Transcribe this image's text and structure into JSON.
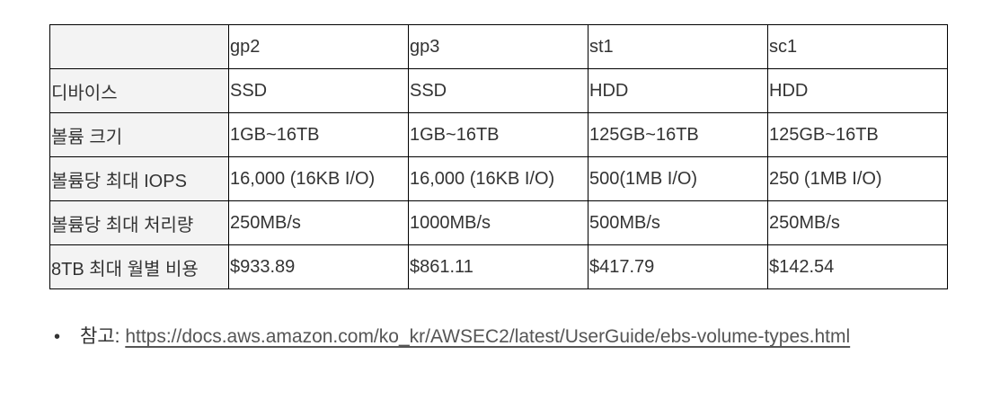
{
  "table": {
    "headers": [
      "",
      "gp2",
      "gp3",
      "st1",
      "sc1"
    ],
    "rows": [
      [
        "디바이스",
        "SSD",
        "SSD",
        "HDD",
        "HDD"
      ],
      [
        "볼륨 크기",
        "1GB~16TB",
        "1GB~16TB",
        "125GB~16TB",
        "125GB~16TB"
      ],
      [
        "볼륨당 최대 IOPS",
        "16,000 (16KB I/O)",
        "16,000 (16KB I/O)",
        "500(1MB I/O)",
        "250 (1MB I/O)"
      ],
      [
        "볼륨당 최대 처리량",
        "250MB/s",
        "1000MB/s",
        "500MB/s",
        "250MB/s"
      ],
      [
        "8TB 최대 월별 비용",
        "$933.89",
        "$861.11",
        "$417.79",
        "$142.54"
      ]
    ]
  },
  "reference": {
    "bullet": "•",
    "label": "참고: ",
    "link_text": "https://docs.aws.amazon.com/ko_kr/AWSEC2/latest/UserGuide/ebs-volume-types.html"
  }
}
